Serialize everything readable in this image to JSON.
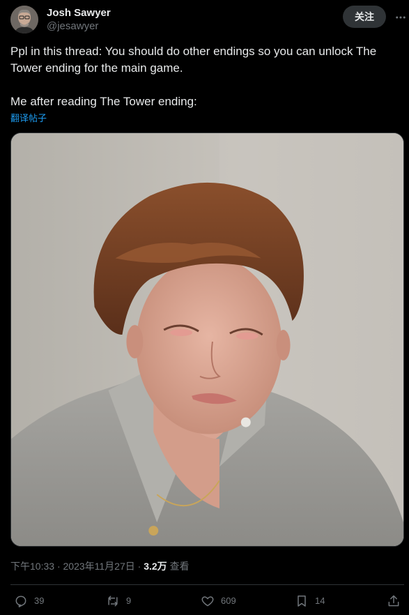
{
  "author": {
    "name": "Josh Sawyer",
    "handle": "@jesawyer"
  },
  "follow_label": "关注",
  "tweet": {
    "text": "Ppl in this thread: You should do other endings so you can unlock The Tower ending for the main game.\n\nMe after reading The Tower ending:",
    "translate_label": "翻译帖子"
  },
  "meta": {
    "time": "下午10:33",
    "separator": "·",
    "date": "2023年11月27日",
    "views_count": "3.2万",
    "views_label": "查看"
  },
  "actions": {
    "replies": "39",
    "retweets": "9",
    "likes": "609",
    "bookmarks": "14"
  },
  "icons": {
    "reply": "reply-icon",
    "retweet": "retweet-icon",
    "like": "heart-icon",
    "bookmark": "bookmark-icon",
    "share": "share-icon",
    "more": "more-icon"
  },
  "colors": {
    "background": "#000000",
    "text": "#e7e9ea",
    "secondary": "#71767b",
    "link": "#1d9bf0",
    "border": "#2f3336"
  }
}
